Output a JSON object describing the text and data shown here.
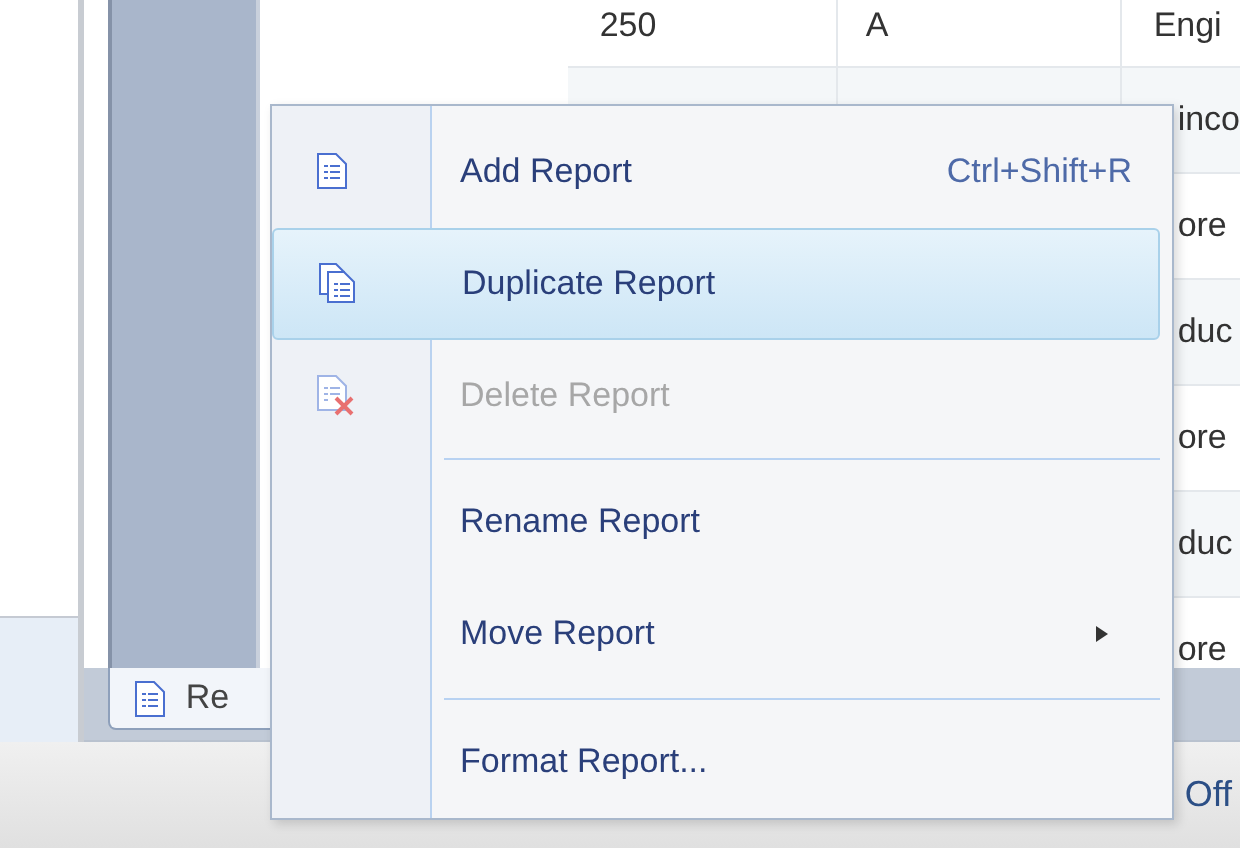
{
  "table": {
    "rows": [
      {
        "column_1": "250",
        "column_2": "A",
        "column_3": "Engi"
      },
      {
        "column_3": "inco"
      },
      {
        "column_3": "ore"
      },
      {
        "column_3": "duc"
      },
      {
        "column_3": "ore"
      },
      {
        "column_3": "duc"
      },
      {
        "column_3": "ore"
      }
    ]
  },
  "sheet_tab": {
    "label": "Re",
    "selected": true
  },
  "status_bar": {
    "text": "Off"
  },
  "context_menu": {
    "items": [
      {
        "kind": "item",
        "label": "Add Report",
        "shortcut": "Ctrl+Shift+R",
        "selected": false,
        "disabled": false,
        "submenu": false
      },
      {
        "kind": "item",
        "label": "Duplicate Report",
        "selected": true,
        "disabled": false,
        "submenu": false
      },
      {
        "kind": "item",
        "label": "Delete Report",
        "selected": false,
        "disabled": true,
        "submenu": false
      },
      {
        "kind": "separator"
      },
      {
        "kind": "item",
        "label": "Rename Report",
        "selected": false,
        "disabled": false,
        "submenu": false
      },
      {
        "kind": "item",
        "label": "Move Report",
        "selected": false,
        "disabled": false,
        "submenu": true
      },
      {
        "kind": "separator"
      },
      {
        "kind": "item",
        "label": "Format Report...",
        "selected": false,
        "disabled": false,
        "submenu": false
      }
    ]
  }
}
